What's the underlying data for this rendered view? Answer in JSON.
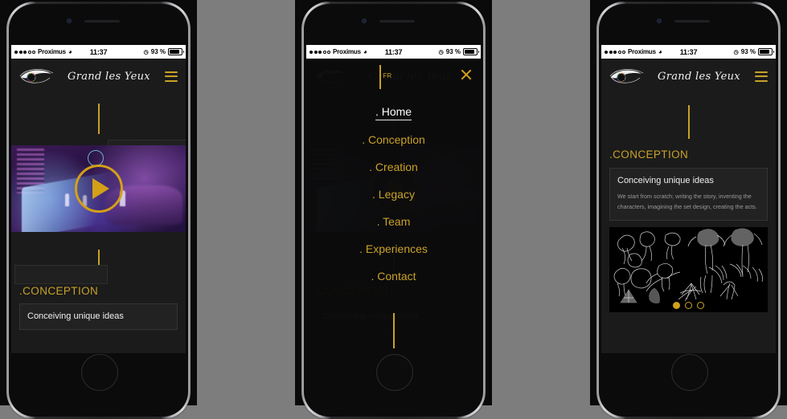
{
  "background_color": "#7d7d7d",
  "accent_gold": "#c9a227",
  "status_bar": {
    "carrier": "Proximus",
    "signal_filled": 3,
    "signal_empty": 2,
    "wifi_icon": "wifi-icon",
    "time": "11:37",
    "alarm_icon": "alarm-icon",
    "battery_percent": "93 %",
    "battery_icon": "battery-icon"
  },
  "header": {
    "logo_icon": "eye-logo-icon",
    "brand": "Grand les Yeux",
    "menu_icon": "hamburger-menu-icon"
  },
  "phone1": {
    "name": "home-screen",
    "video": {
      "play_icon": "play-button-icon",
      "alt": "stage performance video thumbnail"
    },
    "section_title": ".CONCEPTION",
    "card_title": "Conceiving unique ideas"
  },
  "phone2": {
    "name": "menu-overlay-screen",
    "language_toggle": "FR",
    "close_icon": "close-x-icon",
    "menu_items": [
      {
        "label": ". Home",
        "active": true
      },
      {
        "label": ". Conception",
        "active": false
      },
      {
        "label": ". Creation",
        "active": false
      },
      {
        "label": ". Legacy",
        "active": false
      },
      {
        "label": ". Team",
        "active": false
      },
      {
        "label": ". Experiences",
        "active": false
      },
      {
        "label": ". Contact",
        "active": false
      }
    ],
    "background_section_title": ".CONCEPTION",
    "background_card_title": "Conceiving unique ideas"
  },
  "phone3": {
    "name": "conception-screen",
    "section_title": ".CONCEPTION",
    "card_title": "Conceiving unique ideas",
    "card_body": "We start from scratch; writing the story, inventing the characters, imagining the set design, creating the acts.",
    "gallery_alt": "black and white botanical creature sketches",
    "carousel_dots": 3,
    "carousel_active_index": 0
  }
}
